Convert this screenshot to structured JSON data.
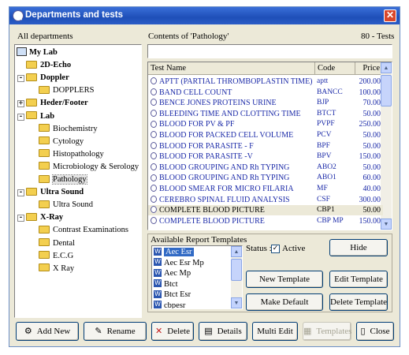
{
  "window": {
    "title": "Departments and tests",
    "icon": "tube-icon"
  },
  "left_panel": {
    "label": "All departments"
  },
  "tree": [
    {
      "label": "My Lab",
      "level": 0,
      "bold": true,
      "type": "root",
      "expander": "-"
    },
    {
      "label": "2D-Echo",
      "level": 1,
      "bold": true,
      "type": "folder",
      "expander": ""
    },
    {
      "label": "Doppler",
      "level": 1,
      "bold": true,
      "type": "folder",
      "expander": "-"
    },
    {
      "label": "DOPPLERS",
      "level": 2,
      "bold": false,
      "type": "folder",
      "expander": ""
    },
    {
      "label": "Heder/Footer",
      "level": 1,
      "bold": true,
      "type": "folder",
      "expander": "+"
    },
    {
      "label": "Lab",
      "level": 1,
      "bold": true,
      "type": "folder",
      "expander": "-"
    },
    {
      "label": "Biochemistry",
      "level": 2,
      "bold": false,
      "type": "folder",
      "expander": ""
    },
    {
      "label": "Cytology",
      "level": 2,
      "bold": false,
      "type": "folder",
      "expander": ""
    },
    {
      "label": "Histopathology",
      "level": 2,
      "bold": false,
      "type": "folder",
      "expander": ""
    },
    {
      "label": "Microbiology & Serology",
      "level": 2,
      "bold": false,
      "type": "folder",
      "expander": ""
    },
    {
      "label": "Pathology",
      "level": 2,
      "bold": false,
      "type": "folder",
      "expander": "",
      "selected": true
    },
    {
      "label": "Ultra Sound",
      "level": 1,
      "bold": true,
      "type": "folder",
      "expander": "-"
    },
    {
      "label": "Ultra Sound",
      "level": 2,
      "bold": false,
      "type": "folder",
      "expander": ""
    },
    {
      "label": "X-Ray",
      "level": 1,
      "bold": true,
      "type": "folder",
      "expander": "-"
    },
    {
      "label": "Contrast Examinations",
      "level": 2,
      "bold": false,
      "type": "folder",
      "expander": ""
    },
    {
      "label": "Dental",
      "level": 2,
      "bold": false,
      "type": "folder",
      "expander": ""
    },
    {
      "label": "E.C.G",
      "level": 2,
      "bold": false,
      "type": "folder",
      "expander": ""
    },
    {
      "label": "X Ray",
      "level": 2,
      "bold": false,
      "type": "folder",
      "expander": ""
    }
  ],
  "contents": {
    "label": "Contents of  'Pathology'",
    "count": "80 - Tests",
    "search_value": ""
  },
  "grid": {
    "columns": [
      "Test Name",
      "Code",
      "Price"
    ],
    "rows": [
      {
        "name": "APTT (PARTIAL THROMBOPLASTIN TIME)",
        "code": "aptt",
        "price": "200.00"
      },
      {
        "name": "BAND CELL COUNT",
        "code": "BANCC",
        "price": "100.00"
      },
      {
        "name": "BENCE JONES PROTEINS  URINE",
        "code": "BJP",
        "price": "70.00"
      },
      {
        "name": "BLEEDING TIME AND CLOTTING TIME",
        "code": "BTCT",
        "price": "50.00"
      },
      {
        "name": "BLOOD FOR  PV & PF",
        "code": "PVPF",
        "price": "250.00"
      },
      {
        "name": "BLOOD FOR PACKED CELL VOLUME",
        "code": "PCV",
        "price": "50.00"
      },
      {
        "name": "BLOOD FOR PARASITE - F",
        "code": "BPF",
        "price": "50.00"
      },
      {
        "name": "BLOOD FOR PARASITE -V",
        "code": "BPV",
        "price": "150.00"
      },
      {
        "name": "BLOOD GROUPING AND Rh TYPING",
        "code": "ABO2",
        "price": "50.00"
      },
      {
        "name": "BLOOD GROUPING AND Rh TYPING",
        "code": "ABO1",
        "price": "60.00"
      },
      {
        "name": "BLOOD SMEAR FOR MICRO FILARIA",
        "code": "MF",
        "price": "40.00"
      },
      {
        "name": "CEREBRO SPINAL FLUID ANALYSIS",
        "code": "CSF",
        "price": "300.00"
      },
      {
        "name": "COMPLETE BLOOD PICTURE",
        "code": "CBP1",
        "price": "50.00",
        "selected": true
      },
      {
        "name": "COMPLETE BLOOD PICTURE",
        "code": "CBP MP",
        "price": "150.00"
      }
    ]
  },
  "templates": {
    "label": "Available Report Templates",
    "items": [
      {
        "label": "Aec Esr",
        "selected": true
      },
      {
        "label": "Aec Esr Mp"
      },
      {
        "label": "Aec Mp"
      },
      {
        "label": "Btct"
      },
      {
        "label": "Btct Esr"
      },
      {
        "label": "cbpesr"
      }
    ],
    "status_label": "Status :",
    "active_label": "Active",
    "active_checked": "✓"
  },
  "buttons": {
    "hide": "Hide",
    "new_template": "New Template",
    "edit_template": "Edit Template",
    "make_default": "Make Default",
    "delete_template": "Delete Template",
    "add_new": "Add New",
    "rename": "Rename",
    "delete": "Delete",
    "details": "Details",
    "multi_edit": "Multi Edit",
    "templates": "Templates",
    "close": "Close"
  },
  "colors": {
    "title_bar": "#245edb",
    "grid_text": "#1b2aa8",
    "selection": "#316ac5",
    "face": "#ece9d8"
  }
}
